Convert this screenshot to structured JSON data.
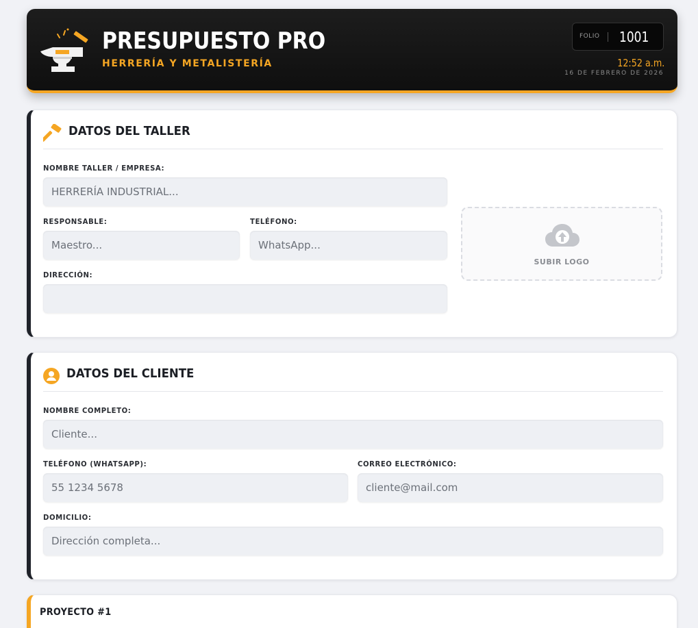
{
  "header": {
    "title": "PRESUPUESTO PRO",
    "subtitle": "HERRERÍA Y METALISTERÍA",
    "folio_label": "FOLIO",
    "folio_value": "1001",
    "time": "12:52 a.m.",
    "date": "16 DE FEBRERO DE 2026",
    "logo_icon": "anvil-icon",
    "accent_color": "#f5a623"
  },
  "taller": {
    "title": "DATOS DEL TALLER",
    "icon": "hammer-icon",
    "nombre_label": "NOMBRE TALLER / EMPRESA:",
    "nombre_placeholder": "HERRERÍA INDUSTRIAL...",
    "nombre_value": "",
    "responsable_label": "RESPONSABLE:",
    "responsable_placeholder": "Maestro...",
    "telefono_label": "TELÉFONO:",
    "telefono_placeholder": "WhatsApp...",
    "direccion_label": "DIRECCIÓN:",
    "direccion_placeholder": "",
    "upload_label": "SUBIR LOGO",
    "upload_icon": "cloud-upload-icon"
  },
  "cliente": {
    "title": "DATOS DEL CLIENTE",
    "icon": "user-circle-icon",
    "nombre_label": "NOMBRE COMPLETO:",
    "nombre_placeholder": "Cliente...",
    "telefono_label": "TELÉFONO (WHATSAPP):",
    "telefono_placeholder": "55 1234 5678",
    "correo_label": "CORREO ELECTRÓNICO:",
    "correo_placeholder": "cliente@mail.com",
    "domicilio_label": "DOMICILIO:",
    "domicilio_placeholder": "Dirección completa..."
  },
  "proyecto": {
    "title": "PROYECTO #1"
  }
}
